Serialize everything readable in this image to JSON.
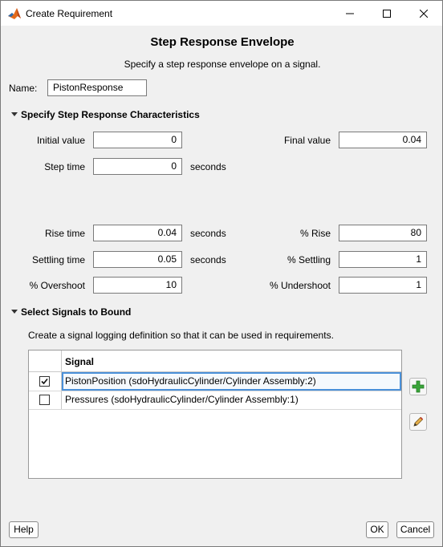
{
  "window": {
    "title": "Create Requirement"
  },
  "header": {
    "title": "Step Response Envelope",
    "subtitle": "Specify a step response envelope on a signal."
  },
  "name": {
    "label": "Name:",
    "value": "PistonResponse"
  },
  "characteristics": {
    "section_label": "Specify Step Response Characteristics",
    "initial_value": {
      "label": "Initial value",
      "value": "0"
    },
    "final_value": {
      "label": "Final value",
      "value": "0.04"
    },
    "step_time": {
      "label": "Step time",
      "value": "0",
      "unit": "seconds"
    },
    "rise_time": {
      "label": "Rise time",
      "value": "0.04",
      "unit": "seconds"
    },
    "percent_rise": {
      "label": "% Rise",
      "value": "80"
    },
    "settling_time": {
      "label": "Settling time",
      "value": "0.05",
      "unit": "seconds"
    },
    "percent_settling": {
      "label": "% Settling",
      "value": "1"
    },
    "percent_overshoot": {
      "label": "% Overshoot",
      "value": "10"
    },
    "percent_undershoot": {
      "label": "% Undershoot",
      "value": "1"
    }
  },
  "signals": {
    "section_label": "Select Signals to Bound",
    "description": "Create a signal logging definition so that it can be used in requirements.",
    "column_header": "Signal",
    "rows": [
      {
        "name": "PistonPosition (sdoHydraulicCylinder/Cylinder Assembly:2)",
        "checked": true,
        "selected": true
      },
      {
        "name": "Pressures (sdoHydraulicCylinder/Cylinder Assembly:1)",
        "checked": false,
        "selected": false
      }
    ],
    "add_icon": "plus-icon",
    "edit_icon": "pencil-icon"
  },
  "footer": {
    "help_label": "Help",
    "ok_label": "OK",
    "cancel_label": "Cancel"
  },
  "colors": {
    "selection_outline": "#4a90d9",
    "add_icon_green": "#3aa53a",
    "matlab_orange": "#e36a1b"
  }
}
